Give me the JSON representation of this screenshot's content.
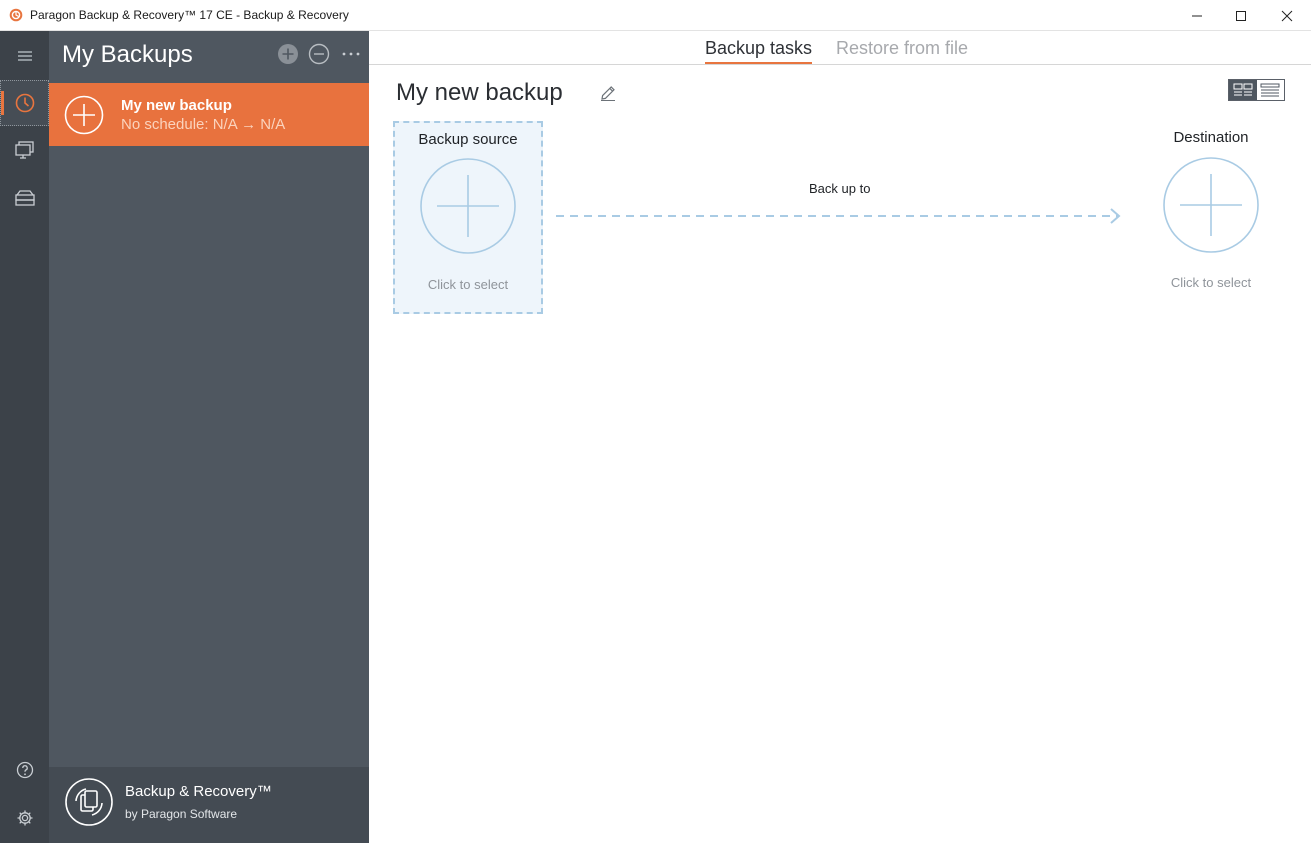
{
  "window": {
    "title": "Paragon Backup & Recovery™ 17 CE - Backup & Recovery"
  },
  "sidebar": {
    "title": "My Backups",
    "items": [
      {
        "name": "My new backup",
        "schedule": "No schedule: N/A → N/A"
      }
    ],
    "footer": {
      "product": "Backup & Recovery™",
      "vendor": "by Paragon Software"
    }
  },
  "main": {
    "tabs": [
      {
        "label": "Backup tasks",
        "active": true
      },
      {
        "label": "Restore from file",
        "active": false
      }
    ],
    "task_title": "My new backup",
    "source": {
      "label": "Backup source",
      "hint": "Click to select"
    },
    "arrow_label": "Back up to",
    "destination": {
      "label": "Destination",
      "hint": "Click to select"
    }
  },
  "colors": {
    "accent": "#e8753f",
    "rail_bg": "#3c4249",
    "panel_bg": "#4f5760",
    "selection": "#a9cbe4"
  },
  "icons": [
    "app-logo-icon",
    "minimize-icon",
    "maximize-icon",
    "close-icon",
    "hamburger-menu-icon",
    "clock-icon",
    "monitor-icon",
    "drive-icon",
    "help-icon",
    "gear-icon",
    "add-icon",
    "remove-icon",
    "more-icon",
    "plus-icon",
    "pencil-icon",
    "tile-view-icon",
    "list-view-icon"
  ]
}
